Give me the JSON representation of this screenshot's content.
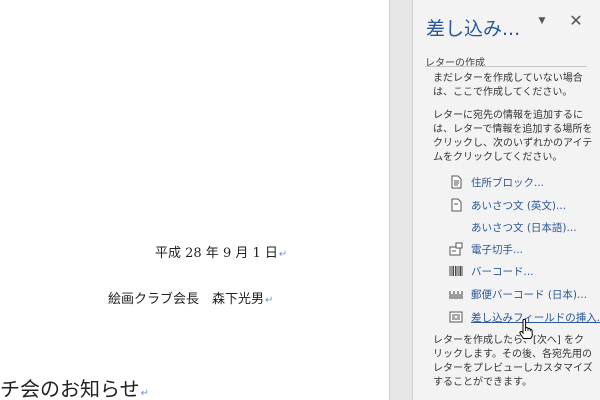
{
  "document": {
    "date_line": "平成 28 年 9 月 1 日",
    "sender_line": "絵画クラブ会長　森下光男",
    "heading_line": "チ会のお知らせ",
    "paragraph_mark": "↵"
  },
  "pane": {
    "title": "差し込み...",
    "dropdown_glyph": "▼",
    "close_glyph": "✕",
    "section_title": "レターの作成",
    "intro_text": "まだレターを作成していない場合は、ここで作成してください。",
    "instruction_text": "レターに宛先の情報を追加するには、レターで情報を追加する場所をクリックし、次のいずれかのアイテムをクリックしてください。",
    "items": [
      {
        "label": "住所ブロック...",
        "icon": "address-block-icon"
      },
      {
        "label": "あいさつ文 (英文)...",
        "icon": "greeting-line-icon"
      },
      {
        "label": "あいさつ文 (日本語)...",
        "icon": ""
      },
      {
        "label": "電子切手...",
        "icon": "electronic-postage-icon"
      },
      {
        "label": "バーコード...",
        "icon": "barcode-icon"
      },
      {
        "label": "郵便バーコード (日本)...",
        "icon": "postal-barcode-icon"
      },
      {
        "label": "差し込みフィールドの挿入...",
        "icon": "insert-merge-field-icon"
      }
    ],
    "footer_text": "レターを作成したら、[次へ] をクリックします。その後、各宛先用のレターをプレビューしカスタマイズすることができます。"
  },
  "colors": {
    "accent": "#2b579a",
    "pane_background": "#f3f3f3",
    "page_background": "#ffffff"
  }
}
